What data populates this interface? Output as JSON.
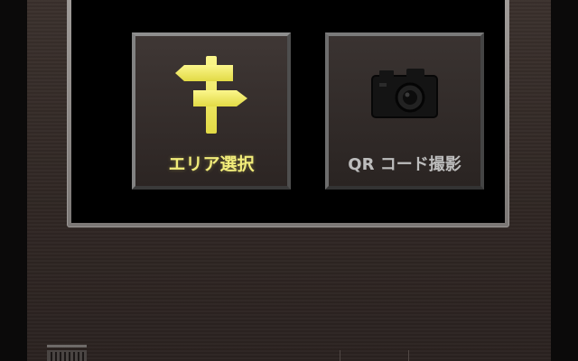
{
  "menu": {
    "area_select": {
      "label": "エリア選択",
      "icon": "signpost-icon",
      "color": "#f1ec7a"
    },
    "qr_scan": {
      "label": "QR コード撮影",
      "icon": "camera-icon",
      "color": "#bdbdbd"
    }
  },
  "colors": {
    "device_body": "#3a302c",
    "panel_frame": "#9a9694",
    "panel_background": "#000000",
    "active_accent": "#f1ec7a"
  },
  "bottom_bar": {
    "left_icon": "barcode-icon"
  }
}
